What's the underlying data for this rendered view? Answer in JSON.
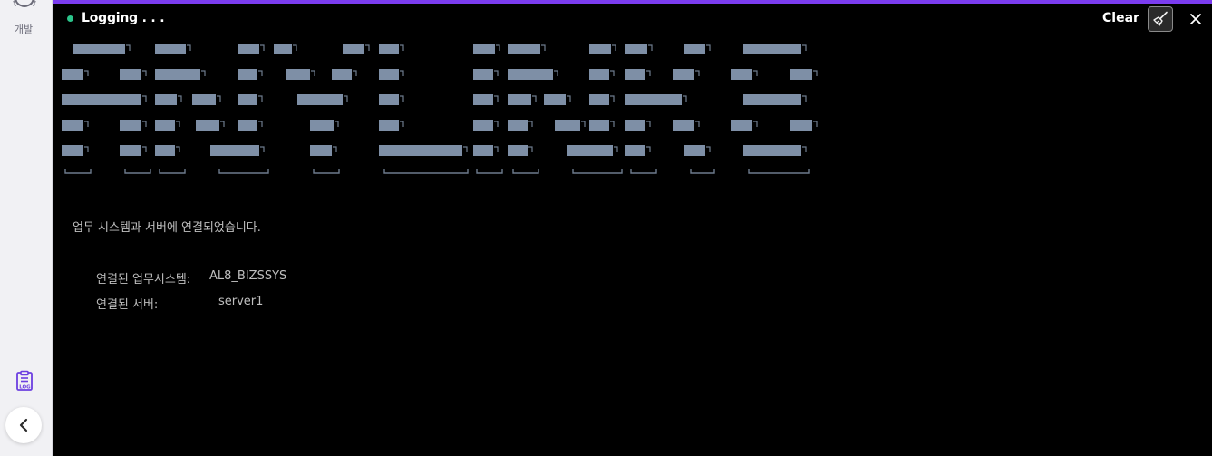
{
  "sidebar": {
    "dev_label": "개발",
    "dev_icon": "code-face-icon",
    "log_icon": "log-clipboard-icon",
    "collapse_icon": "chevron-left-icon"
  },
  "header": {
    "title": "Logging . . .",
    "clear_label": "Clear",
    "broom_icon": "broom-icon",
    "close_icon": "close-icon"
  },
  "colors": {
    "accent": "#7b3cf0",
    "status_dot": "#2bc48a",
    "banner_fill": "#7e8fa6",
    "banner_line": "#6d7b8d"
  },
  "log": {
    "connect_message": "업무 시스템과 서버에 연결되었습니다.",
    "rows": [
      {
        "label": "연결된 업무시스템:",
        "value": "AL8_BIZSSYS"
      },
      {
        "label": "연결된 서버:",
        "value": "server1"
      }
    ]
  }
}
